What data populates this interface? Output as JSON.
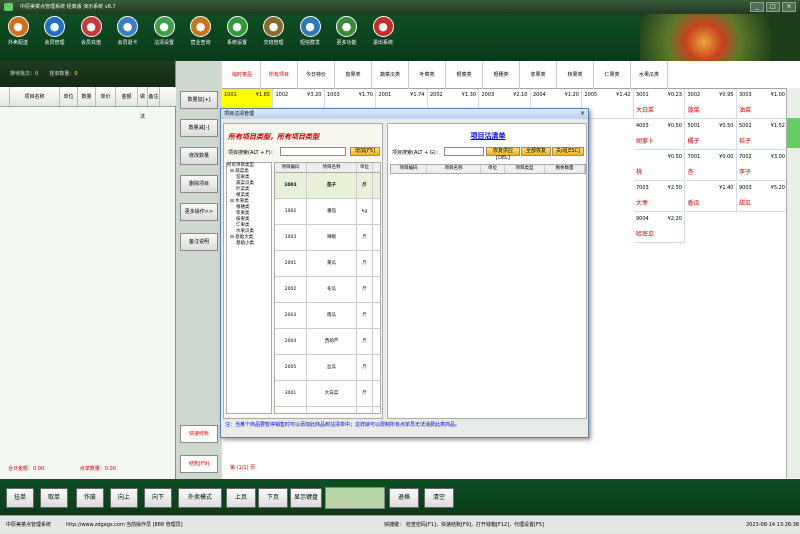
{
  "window": {
    "title": "中原美菜点管理系统 经典版 演示系统 v8.7"
  },
  "toolbar": {
    "items": [
      {
        "label": "外卖配送",
        "icon": "scooter-icon"
      },
      {
        "label": "会员管理",
        "icon": "member-icon"
      },
      {
        "label": "会员充值",
        "icon": "card-icon"
      },
      {
        "label": "会员退卡",
        "icon": "card-return-icon"
      },
      {
        "label": "沽清设置",
        "icon": "food-icon"
      },
      {
        "label": "营业查询",
        "icon": "search-icon"
      },
      {
        "label": "系统设置",
        "icon": "gear-icon"
      },
      {
        "label": "交班管理",
        "icon": "clipboard-icon"
      },
      {
        "label": "短信群发",
        "icon": "message-icon"
      },
      {
        "label": "更多功能",
        "icon": "more-icon"
      },
      {
        "label": "退出系统",
        "icon": "power-icon"
      }
    ]
  },
  "left": {
    "info": {
      "batch_label": "排待批次：",
      "batch_value": "0",
      "hang_label": "挂单数量：",
      "hang_value": "0"
    },
    "columns": [
      "",
      "项目名称",
      "单位",
      "数量",
      "单价",
      "金额",
      "做法",
      "备注"
    ],
    "footer": {
      "total_label": "合计金额：",
      "total_value": "0.00",
      "count_label": "点单数量：",
      "count_value": "0.00"
    }
  },
  "mid_buttons": [
    "数量加[+]",
    "数量减[-]",
    "修改数量",
    "删除项目",
    "更多操作>>",
    "备注说明",
    "快速结账",
    "结账[F9]"
  ],
  "categories": [
    "临时菜品",
    "所有项目",
    "今日特价",
    "茄果类",
    "蔬菜瓜类",
    "叶菜类",
    "根菜类",
    "根穗类",
    "浆果类",
    "核果类",
    "仁果类",
    "水果瓜类"
  ],
  "dishes": [
    {
      "code": "1001",
      "price": "¥1.65",
      "name": ""
    },
    {
      "code": "1002",
      "price": "¥3.20",
      "name": ""
    },
    {
      "code": "1003",
      "price": "¥1.70",
      "name": ""
    },
    {
      "code": "2001",
      "price": "¥1.74",
      "name": ""
    },
    {
      "code": "2002",
      "price": "¥1.30",
      "name": ""
    },
    {
      "code": "2003",
      "price": "¥2.10",
      "name": ""
    },
    {
      "code": "2004",
      "price": "¥1.20",
      "name": ""
    },
    {
      "code": "2005",
      "price": "¥1.42",
      "name": ""
    },
    {
      "code": "3001",
      "price": "¥0.23",
      "name": "大白菜"
    },
    {
      "code": "3002",
      "price": "¥0.95",
      "name": "菠菜"
    },
    {
      "code": "3003",
      "price": "¥1.00",
      "name": "油菜"
    },
    {
      "code": "4003",
      "price": "¥0.50",
      "name": "胡萝卜"
    },
    {
      "code": "5001",
      "price": "¥0.50",
      "name": "橘子"
    },
    {
      "code": "5002",
      "price": "¥1.52",
      "name": "桔子"
    },
    {
      "code": "",
      "price": "¥0.50",
      "name": "桃"
    },
    {
      "code": "7001",
      "price": "¥0.00",
      "name": "杏"
    },
    {
      "code": "7002",
      "price": "¥3.00",
      "name": "李子"
    },
    {
      "code": "7003",
      "price": "¥2.50",
      "name": "大枣"
    },
    {
      "code": "",
      "price": "¥1.40",
      "name": "香瓜"
    },
    {
      "code": "9003",
      "price": "¥5.20",
      "name": "甜瓜"
    },
    {
      "code": "9004",
      "price": "¥2.20",
      "name": "哈密瓜"
    }
  ],
  "pager": "第 (1/1) 页",
  "bottom_buttons": [
    "挂单",
    "取单",
    "作废",
    "向上",
    "向下",
    "外卖模式",
    "上页",
    "下页",
    "显示键盘",
    "退格",
    "清空"
  ],
  "status": {
    "app": "中原美菜点管理系统",
    "url": "http://www.zdgegs.com",
    "user": "当前操作员 [888 管理员]",
    "shortcut_label": "快捷键：",
    "shortcuts": "检查密码[F1]，快速结账[F9]，打开钱箱[F12]，代理设置[F5]",
    "datetime": "2023-08-14 13:26:38"
  },
  "dialog": {
    "title": "项目沽清管理",
    "close": "×",
    "left_heading": "所有项目类型，所有项目类型",
    "left_search_label": "项目搜索(ALT + F)：",
    "left_add_btn": "增加[F5]",
    "right_heading": "项目沽清单",
    "right_search_label": "项目搜索(ALT + G)：",
    "right_btns": [
      "恢复供应[DEL]",
      "全部恢复",
      "关闭[ESC]"
    ],
    "tree": [
      "所有项目类型",
      "⊟ 蔬菜类",
      "茄果类",
      "蔬菜瓜类",
      "叶菜类",
      "根菜类",
      "⊟ 水果类",
      "根穗类",
      "浆果类",
      "核果类",
      "仁果类",
      "水果瓜类",
      "⊟ 基础大类",
      "基础小类"
    ],
    "item_cols": [
      "项目编码",
      "项目名称",
      "单位"
    ],
    "items": [
      {
        "code": "1001",
        "name": "茄子",
        "unit": "斤"
      },
      {
        "code": "1002",
        "name": "番茄",
        "unit": "kg"
      },
      {
        "code": "1003",
        "name": "辣椒",
        "unit": "斤"
      },
      {
        "code": "2001",
        "name": "黄瓜",
        "unit": "斤"
      },
      {
        "code": "2002",
        "name": "冬瓜",
        "unit": "斤"
      },
      {
        "code": "2003",
        "name": "南瓜",
        "unit": "斤"
      },
      {
        "code": "2004",
        "name": "西葫芦",
        "unit": "斤"
      },
      {
        "code": "2005",
        "name": "丝瓜",
        "unit": "斤"
      },
      {
        "code": "3001",
        "name": "大白菜",
        "unit": "斤"
      },
      {
        "code": "3002",
        "name": "菠菜",
        "unit": "斤"
      },
      {
        "code": "3003",
        "name": "油菜",
        "unit": "斤"
      }
    ],
    "order_cols": [
      "项目编码",
      "项目名称",
      "单位",
      "项目类型",
      "剩余数量"
    ],
    "note": "注：当某个商品要暂停销售时可以添加此商品到沽清单中；这样就可以限制所有点单员无法消费此类商品。"
  }
}
